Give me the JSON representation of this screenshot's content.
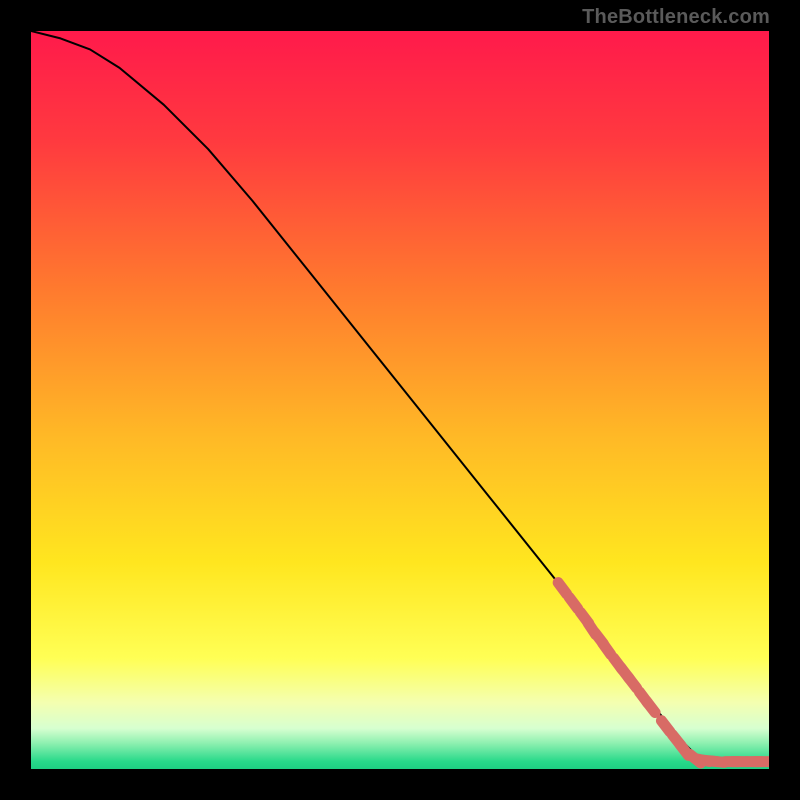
{
  "attribution": "TheBottleneck.com",
  "colors": {
    "frame_bg_black": "#000000",
    "curve": "#000000",
    "marker": "#d86b65",
    "gradient_stops": [
      {
        "offset": 0.0,
        "color": "#ff1a4b"
      },
      {
        "offset": 0.15,
        "color": "#ff3a3f"
      },
      {
        "offset": 0.35,
        "color": "#ff7a2e"
      },
      {
        "offset": 0.55,
        "color": "#ffb926"
      },
      {
        "offset": 0.72,
        "color": "#ffe61f"
      },
      {
        "offset": 0.85,
        "color": "#ffff55"
      },
      {
        "offset": 0.91,
        "color": "#f4ffb0"
      },
      {
        "offset": 0.945,
        "color": "#d7ffd0"
      },
      {
        "offset": 0.965,
        "color": "#8ef0b0"
      },
      {
        "offset": 0.99,
        "color": "#27d98a"
      },
      {
        "offset": 1.0,
        "color": "#1ecf83"
      }
    ]
  },
  "chart_data": {
    "type": "line",
    "title": "",
    "xlabel": "",
    "ylabel": "",
    "xlim": [
      0,
      100
    ],
    "ylim": [
      0,
      100
    ],
    "series": [
      {
        "name": "curve",
        "x": [
          0,
          4,
          8,
          12,
          18,
          24,
          30,
          38,
          46,
          54,
          62,
          70,
          78,
          84,
          88,
          90,
          92,
          95,
          98,
          100
        ],
        "y": [
          100,
          99,
          97.5,
          95,
          90,
          84,
          77,
          67,
          57,
          47,
          37,
          27,
          17,
          9,
          4,
          2,
          1.2,
          1.0,
          1.0,
          1.0
        ]
      }
    ],
    "markers": {
      "name": "dense-segment",
      "x": [
        72,
        73.5,
        75,
        76,
        77,
        78,
        79.5,
        80.5,
        81.5,
        83,
        84,
        86,
        87.5,
        88.5,
        90,
        91,
        92,
        93,
        95,
        96,
        98,
        99
      ],
      "y": [
        24.5,
        22.5,
        20.5,
        19,
        17.7,
        16.3,
        14.3,
        13,
        11.7,
        9.7,
        8.4,
        5.8,
        3.9,
        2.6,
        1.4,
        1.2,
        1.1,
        1.0,
        1.0,
        1.0,
        1.0,
        1.0
      ]
    }
  }
}
